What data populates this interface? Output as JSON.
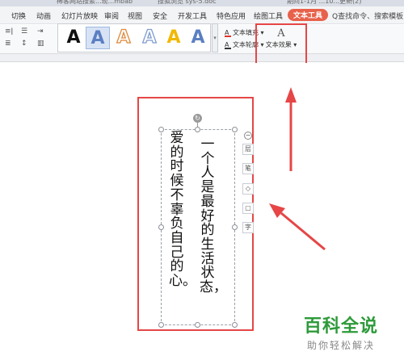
{
  "titlebar": {
    "tabs": [
      "稀客网站搜索...现...mbab",
      "搜狐浏览 sys-5.doc",
      "期间1-1月 ...10...更新(2)"
    ]
  },
  "menubar": {
    "items": [
      "切换",
      "动画",
      "幻灯片放映",
      "审阅",
      "视图",
      "安全",
      "开发工具",
      "特色应用",
      "绘图工具"
    ],
    "active_tab": "文本工具",
    "search": "Q查找命令、搜索模板"
  },
  "ribbon": {
    "gallery_letter": "A",
    "text_fill": "文本填充",
    "text_outline": "文本轮廓",
    "text_effects": "文本效果"
  },
  "document": {
    "column1": "一个人是最好的生活状态，",
    "column2": "爱的时候不辜负自己的心。"
  },
  "float_tools": [
    "层",
    "笔",
    "◇",
    "▢",
    "字"
  ],
  "watermark": {
    "main": "百科全说",
    "sub": "助你轻松解决"
  },
  "colors": {
    "accent": "#e8614a",
    "annotation": "#e64646",
    "watermark_green": "#2e9a3a"
  }
}
